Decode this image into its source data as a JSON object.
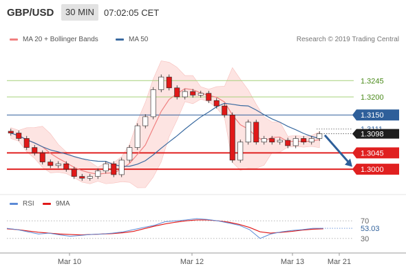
{
  "header": {
    "pair": "GBP/USD",
    "timeframe": "30 MIN",
    "time": "07:02:05 CET"
  },
  "legend": {
    "ma20_bb": "MA 20 + Bollinger Bands",
    "ma50": "MA 50",
    "source": "Research © 2019 Trading Central",
    "rsi": "RSI",
    "rsi_ma": "9MA"
  },
  "colors": {
    "resistance_green": "#a6d07a",
    "pivot_blue": "#2e5f9a",
    "support_red": "#e02020",
    "band_fill": "#fde0de",
    "ma20": "#f08080",
    "ma50": "#3a6aa0",
    "candle_up": "#ffffff",
    "candle_down": "#e01818",
    "current_price_bg": "#1e1e1e",
    "rsi_line": "#5b8ad6",
    "rsi_ma": "#e01818",
    "arrow": "#2e5f9a"
  },
  "chart_data": {
    "type": "candlestick",
    "instrument": "GBP/USD",
    "timeframe": "30 MIN",
    "xticks": [
      "Mar 10",
      "Mar 12",
      "Mar 13",
      "Mar 21"
    ],
    "ylim": [
      1.2945,
      1.3335
    ],
    "levels": [
      {
        "label": "1.3245",
        "value": 1.3245,
        "color": "#a6d07a",
        "kind": "resistance"
      },
      {
        "label": "1.3200",
        "value": 1.32,
        "color": "#a6d07a",
        "kind": "resistance"
      },
      {
        "label": "1.3150",
        "value": 1.315,
        "color": "#2e5f9a",
        "kind": "pivot"
      },
      {
        "label": "1.3045",
        "value": 1.3045,
        "color": "#e02020",
        "kind": "support"
      },
      {
        "label": "1.3000",
        "value": 1.3,
        "color": "#e02020",
        "kind": "support"
      }
    ],
    "marker_label": "1.3111",
    "current_label": "1.3098",
    "current_value": 1.3098,
    "close_path": [
      1.31,
      1.3085,
      1.306,
      1.3045,
      1.302,
      1.301,
      1.3015,
      1.3,
      1.298,
      1.2975,
      1.298,
      1.2995,
      1.3015,
      1.2985,
      1.3025,
      1.306,
      1.312,
      1.3145,
      1.322,
      1.3255,
      1.3225,
      1.32,
      1.3215,
      1.3205,
      1.321,
      1.319,
      1.3175,
      1.315,
      1.3025,
      1.3075,
      1.313,
      1.3075,
      1.3085,
      1.3075,
      1.308,
      1.3065,
      1.3085,
      1.3075,
      1.3085,
      1.3098
    ],
    "rsi": {
      "levels": [
        70,
        30
      ],
      "current_label": "53.03",
      "current_value": 53.03,
      "ylim": [
        0,
        100
      ],
      "values": [
        53,
        50,
        45,
        40,
        42,
        38,
        35,
        37,
        39,
        40,
        42,
        45,
        50,
        55,
        60,
        68,
        70,
        72,
        75,
        73,
        70,
        65,
        60,
        50,
        30,
        40,
        45,
        48,
        50,
        53,
        53
      ],
      "ma_values": [
        52,
        50,
        47,
        44,
        42,
        40,
        39,
        38,
        39,
        40,
        41,
        43,
        46,
        52,
        58,
        63,
        67,
        70,
        72,
        72,
        70,
        67,
        62,
        55,
        45,
        42,
        44,
        46,
        49,
        51,
        52
      ]
    }
  }
}
